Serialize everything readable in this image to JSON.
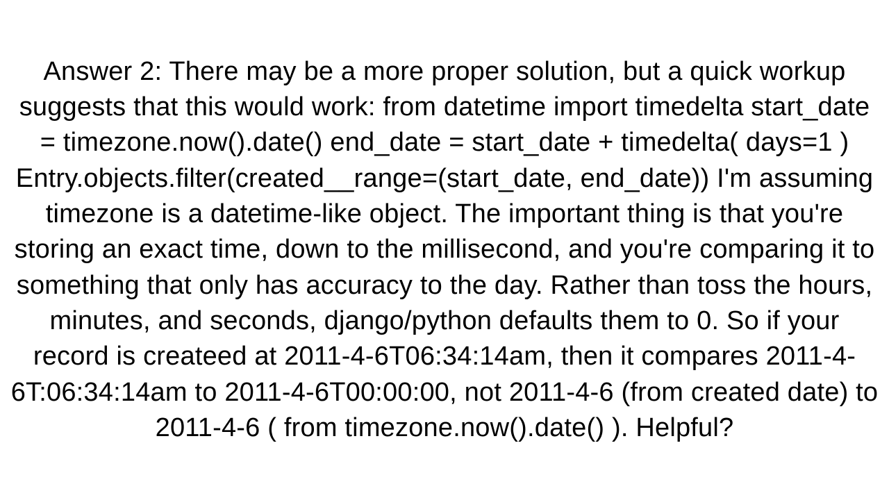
{
  "answer": {
    "text": "Answer 2: There may be a more proper solution, but a quick workup suggests that this would work: from datetime import timedelta  start_date = timezone.now().date() end_date = start_date + timedelta( days=1 ) Entry.objects.filter(created__range=(start_date, end_date)) I'm assuming timezone is a datetime-like object. The important thing is that you're storing an exact time, down to the millisecond, and you're comparing it to something that only has accuracy to the day.  Rather than toss the hours, minutes, and seconds, django/python defaults them to 0.  So if your record is createed at 2011-4-6T06:34:14am, then it compares 2011-4-6T:06:34:14am to 2011-4-6T00:00:00, not 2011-4-6 (from created date) to 2011-4-6 ( from timezone.now().date() ).  Helpful?"
  }
}
